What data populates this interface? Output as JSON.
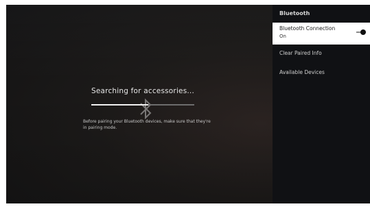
{
  "screen": {
    "searching_text": "Searching for accessories...",
    "help_text": "Before pairing your Bluetooth devices, make sure that they're in pairing mode.",
    "progress_fraction": 0.55
  },
  "sidebar": {
    "title": "Bluetooth",
    "items": [
      {
        "label": "Bluetooth Connection",
        "sublabel": "On",
        "toggle_on": true,
        "selected": true
      },
      {
        "label": "Clear Paired Info"
      },
      {
        "label": "Available Devices"
      }
    ]
  },
  "icons": {
    "center": "bluetooth-icon",
    "toggle": "toggle-switch-icon"
  },
  "colors": {
    "background": "#171616",
    "sidebar_background": "#101114",
    "selected_background": "#ffffff",
    "progress_fill": "#f2f2f2",
    "progress_track": "#6d6d6d"
  }
}
